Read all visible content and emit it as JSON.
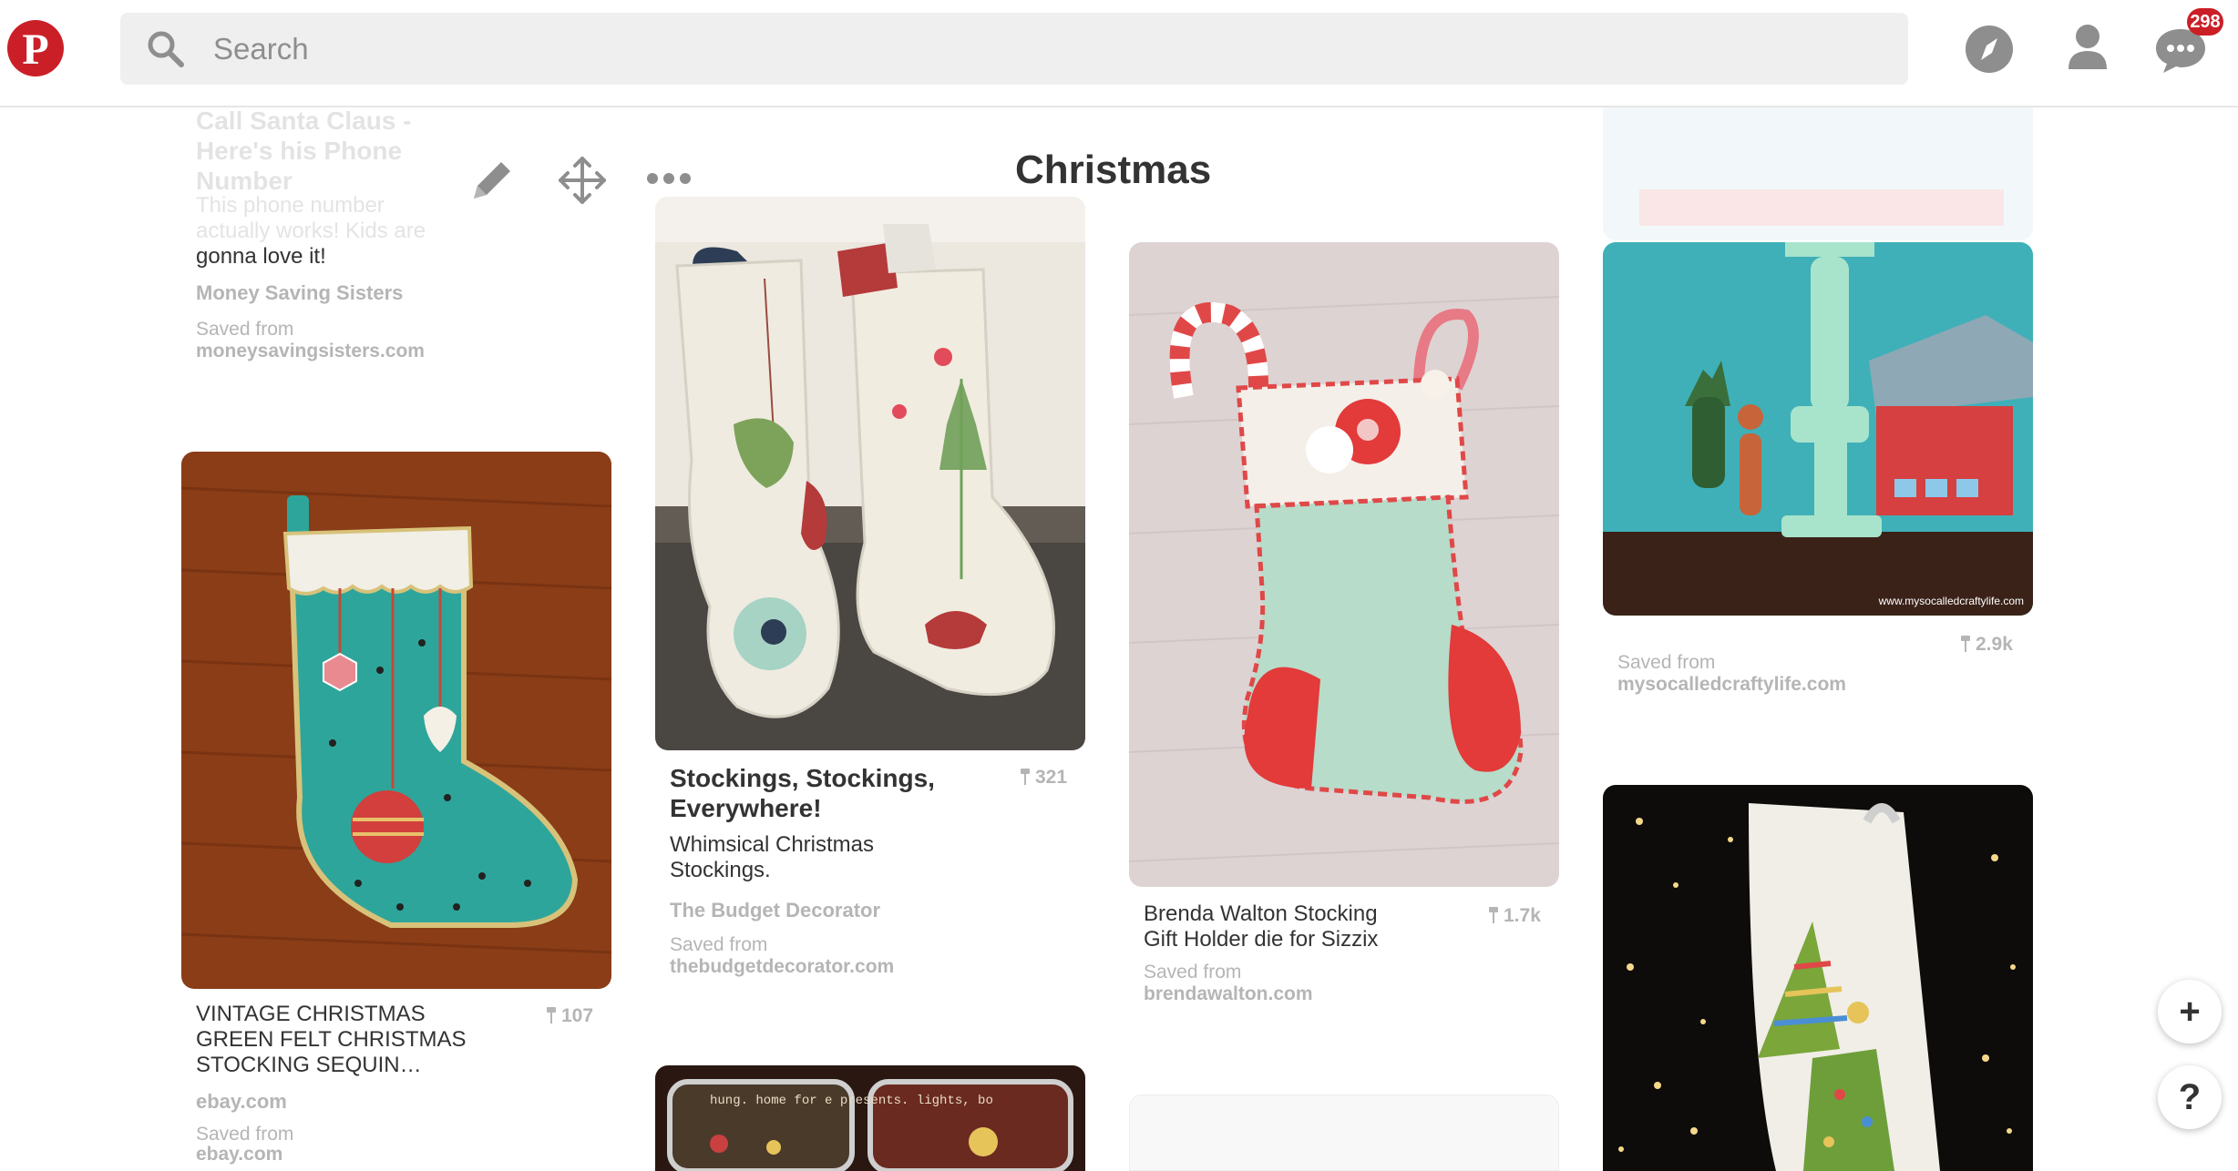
{
  "header": {
    "logo_icon": "pinterest-logo",
    "search_placeholder": "Search",
    "explore_icon": "compass-icon",
    "profile_icon": "user-icon",
    "messages_icon": "chat-bubble-icon",
    "notification_count": "298",
    "brand_color": "#cb1f27"
  },
  "board": {
    "title": "Christmas",
    "tools": [
      "pencil-icon",
      "move-icon",
      "more-icon"
    ]
  },
  "pins": [
    {
      "desc_faded_title": "Call Santa Claus - Here's his Phone Number",
      "desc_faded": "This phone number actually works! Kids are",
      "desc": "gonna love it!",
      "source": "Money Saving Sisters",
      "saved_label": "Saved from",
      "domain": "moneysavingsisters.com"
    },
    {
      "title": "VINTAGE CHRISTMAS GREEN FELT CHRISTMAS STOCKING SEQUIN…",
      "repins": "107",
      "source": "ebay.com",
      "saved_label": "Saved from",
      "domain": "ebay.com"
    },
    {
      "title": "Stockings, Stockings, Everywhere!",
      "repins": "321",
      "desc": "Whimsical Christmas Stockings.",
      "source": "The Budget Decorator",
      "saved_label": "Saved from",
      "domain": "thebudgetdecorator.com"
    },
    {
      "title": "Brenda Walton Stocking Gift Holder die for Sizzix",
      "repins": "1.7k",
      "saved_label": "Saved from",
      "domain": "brendawalton.com"
    },
    {
      "repins": "2.9k",
      "saved_label": "Saved from",
      "domain": "mysocalledcraftylife.com",
      "watermark": "www.mysocalledcraftylife.com"
    },
    {
      "tin_text": "hung. home for e presents. lights, bo"
    }
  ],
  "fab": {
    "add": "+",
    "help": "?"
  }
}
